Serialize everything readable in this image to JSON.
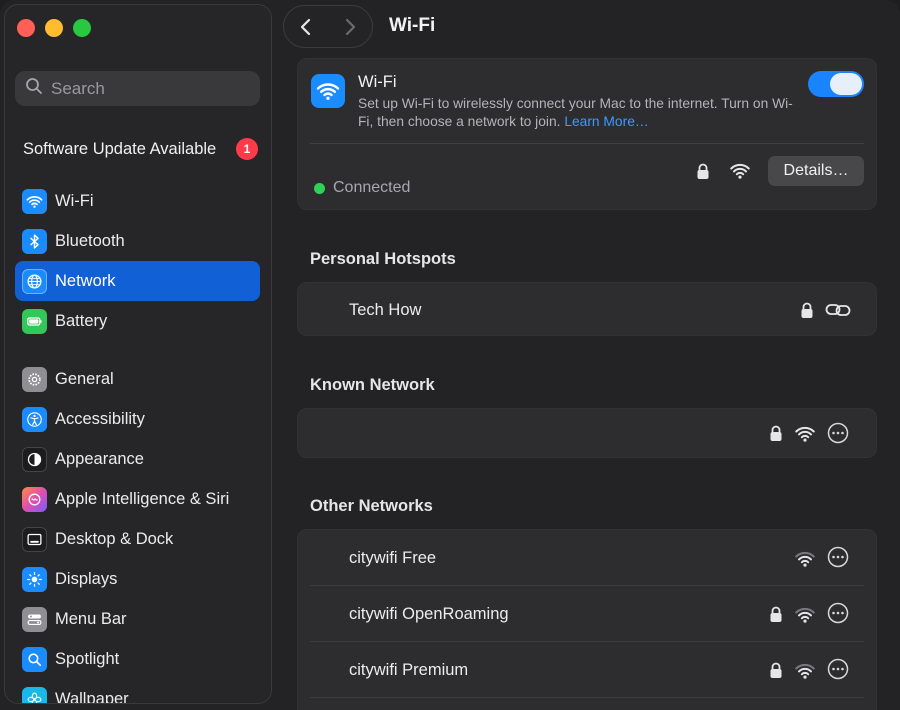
{
  "window": {
    "traffic_lights": {
      "close": "#ff5f57",
      "minimize": "#febc2e",
      "zoom": "#28c840"
    }
  },
  "sidebar": {
    "search_placeholder": "Search",
    "update": {
      "label": "Software Update Available",
      "count": "1"
    },
    "group1": [
      {
        "id": "wifi",
        "label": "Wi-Fi",
        "icon": "wifi-icon",
        "color": "#1a8cff"
      },
      {
        "id": "bluetooth",
        "label": "Bluetooth",
        "icon": "bluetooth-icon",
        "color": "#1a8cff"
      },
      {
        "id": "network",
        "label": "Network",
        "icon": "globe-icon",
        "color": "#1a8cff",
        "active": true
      },
      {
        "id": "battery",
        "label": "Battery",
        "icon": "battery-icon",
        "color": "#32c759"
      }
    ],
    "group2": [
      {
        "id": "general",
        "label": "General",
        "icon": "gear-icon",
        "color": "#8e8e93"
      },
      {
        "id": "accessibility",
        "label": "Accessibility",
        "icon": "accessibility-icon",
        "color": "#1a8cff"
      },
      {
        "id": "appearance",
        "label": "Appearance",
        "icon": "appearance-icon",
        "color": "#1c1c1e"
      },
      {
        "id": "siri",
        "label": "Apple Intelligence & Siri",
        "icon": "siri-icon",
        "color": "#c86dd7"
      },
      {
        "id": "desktop",
        "label": "Desktop & Dock",
        "icon": "dock-icon",
        "color": "#1c1c1e"
      },
      {
        "id": "displays",
        "label": "Displays",
        "icon": "sun-icon",
        "color": "#1a8cff"
      },
      {
        "id": "menubar",
        "label": "Menu Bar",
        "icon": "menubar-icon",
        "color": "#8e8e93"
      },
      {
        "id": "spotlight",
        "label": "Spotlight",
        "icon": "magnifier-icon",
        "color": "#1a8cff"
      },
      {
        "id": "wallpaper",
        "label": "Wallpaper",
        "icon": "flower-icon",
        "color": "#1ab8e8"
      }
    ]
  },
  "toolbar": {
    "title": "Wi-Fi"
  },
  "wifi": {
    "title": "Wi-Fi",
    "description": "Set up Wi-Fi to wirelessly connect your Mac to the internet. Turn on Wi-Fi, then choose a network to join.",
    "learn_more": "Learn More…",
    "enabled": true,
    "status": "Connected",
    "details_label": "Details…"
  },
  "personal_hotspots": {
    "title": "Personal Hotspots",
    "items": [
      {
        "name": "Tech How",
        "locked": true
      }
    ]
  },
  "known_network": {
    "title": "Known Network",
    "items": [
      {
        "name": "",
        "locked": true
      }
    ]
  },
  "other_networks": {
    "title": "Other Networks",
    "items": [
      {
        "name": "citywifi Free",
        "locked": false
      },
      {
        "name": "citywifi OpenRoaming",
        "locked": true
      },
      {
        "name": "citywifi Premium",
        "locked": true
      }
    ]
  }
}
